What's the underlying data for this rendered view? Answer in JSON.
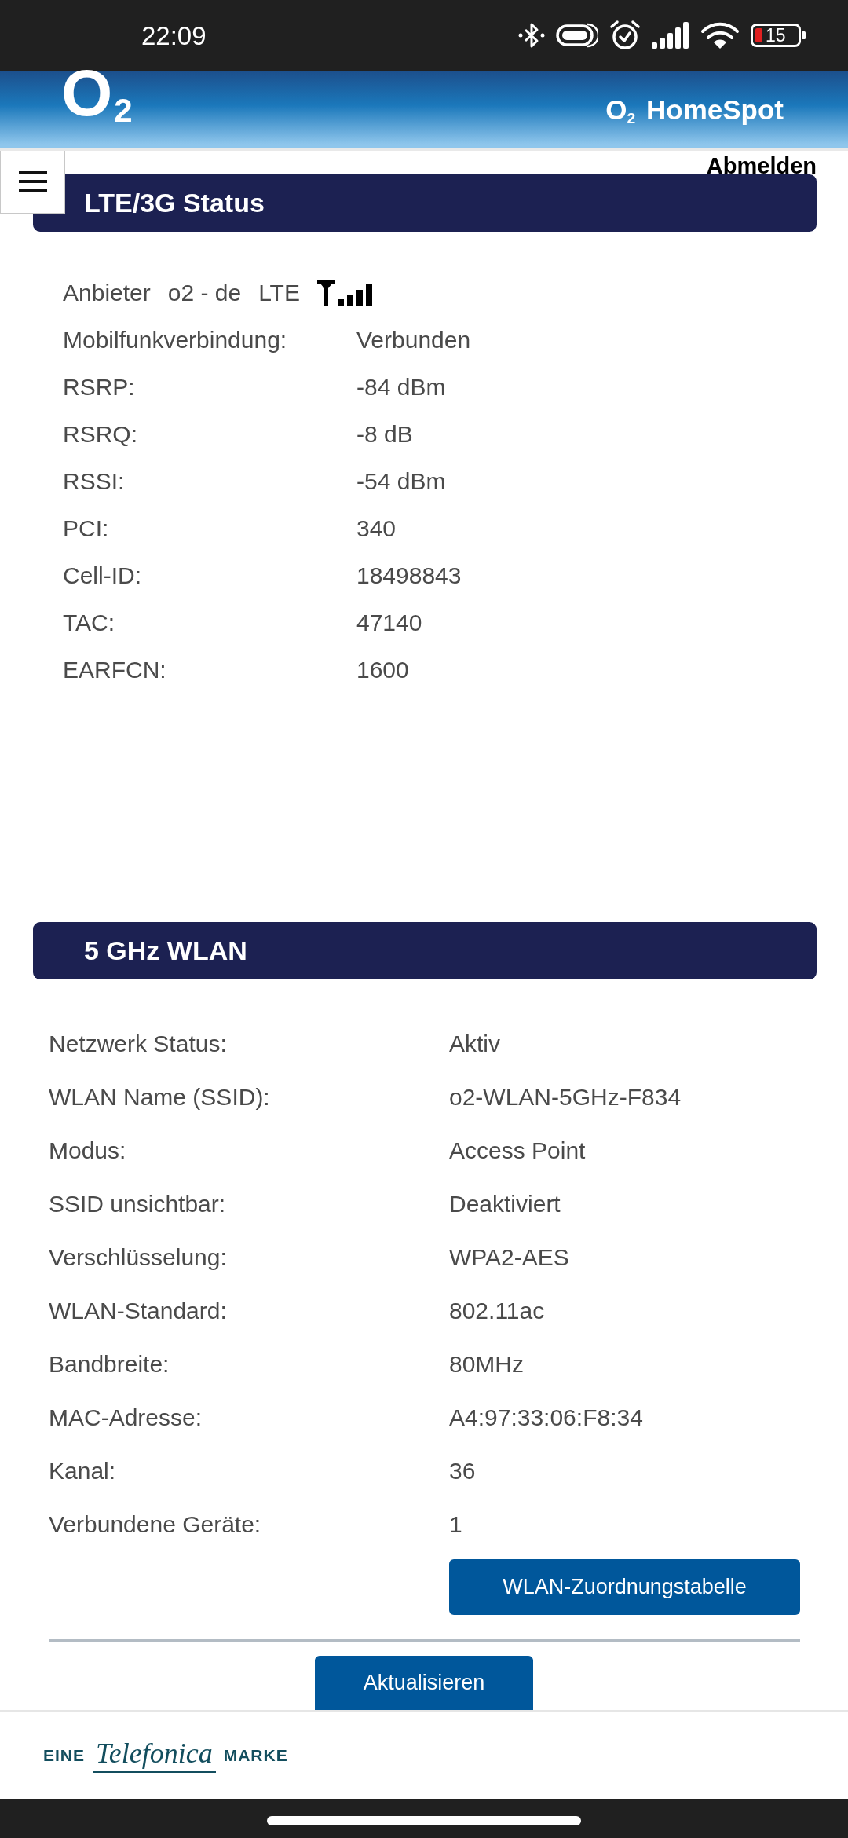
{
  "status_bar": {
    "time": "22:09",
    "battery": "15"
  },
  "header": {
    "logo": "O$_{2}$",
    "product": "O$_{2}$ HomeSpot",
    "logout": "Abmelden"
  },
  "sections": [
    {
      "kind": "lte",
      "title": "LTE/3G Status",
      "provider": {
        "label": "Anbieter",
        "name": "o2 - de",
        "technology": "LTE"
      },
      "rows": [
        {
          "label": "Mobilfunkverbindung:",
          "value": "Verbunden"
        },
        {
          "label": "RSRP:",
          "value": "-84 dBm"
        },
        {
          "label": "RSRQ:",
          "value": "-8 dB"
        },
        {
          "label": "RSSI:",
          "value": "-54 dBm"
        },
        {
          "label": "PCI:",
          "value": "340"
        },
        {
          "label": "Cell-ID:",
          "value": "18498843"
        },
        {
          "label": "TAC:",
          "value": "47140"
        },
        {
          "label": "EARFCN:",
          "value": "1600"
        }
      ]
    },
    {
      "kind": "wlan",
      "title": "5 GHz WLAN",
      "rows": [
        {
          "label": "Netzwerk Status:",
          "value": "Aktiv"
        },
        {
          "label": "WLAN Name (SSID):",
          "value": "o2-WLAN-5GHz-F834"
        },
        {
          "label": "Modus:",
          "value": "Access Point"
        },
        {
          "label": "SSID unsichtbar:",
          "value": "Deaktiviert"
        },
        {
          "label": "Verschlüsselung:",
          "value": "WPA2-AES"
        },
        {
          "label": "WLAN-Standard:",
          "value": "802.11ac"
        },
        {
          "label": "Bandbreite:",
          "value": "80MHz"
        },
        {
          "label": "MAC-Adresse:",
          "value": "A4:97:33:06:F8:34"
        },
        {
          "label": "Kanal:",
          "value": "36"
        },
        {
          "label": "Verbundene Geräte:",
          "value": "1"
        }
      ],
      "button": "WLAN-Zuordnungstabelle"
    }
  ],
  "refresh_button": "Aktualisieren",
  "footer": {
    "prefix": "EINE",
    "brand": "Telefonica",
    "suffix": "MARKE"
  }
}
